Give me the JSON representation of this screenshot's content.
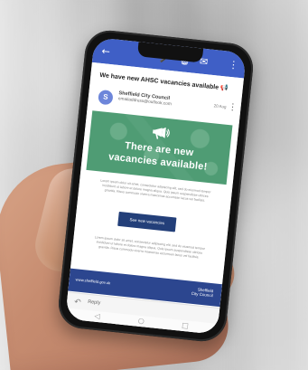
{
  "email": {
    "subject": "We have new AHSC vacancies available 📢",
    "sender_initial": "S",
    "sender_name": "Sheffield City Council",
    "sender_email": "emailaddress@outlook.com",
    "date": "20 Aug",
    "hero_line1": "There are new",
    "hero_line2": "vacancies available!",
    "body_text_1": "Lorem ipsum dolor sit amet, consectetur adipiscing elit, sed do eiusmod tempor incididunt ut labore et dolore magna aliqua. Quis ipsum suspendisse ultrices gravida. Risus commodo viverra maecenas accumsan lacus vel facilisis.",
    "button_label": "See new vacancies",
    "body_text_2": "Lorem ipsum dolor sit amet, consectetur adipiscing elit, sed do eiusmod tempor incididunt ut labore et dolore magna aliqua. Quis ipsum suspendisse ultrices gravida. Risus commodo viverra maecenas accumsan lacus vel facilisis.",
    "footer_site": "www.sheffield.gov.uk",
    "footer_mark_line1": "Sheffield",
    "footer_mark_line2": "City Council",
    "reply_label": "Reply"
  },
  "icons": {
    "back": "←",
    "mic": "🎤",
    "trash": "🗑",
    "mail": "✉",
    "more": "⋮",
    "kebab": "⋮",
    "reply": "↶",
    "nav_back": "◁",
    "nav_home": "○",
    "nav_recent": "□"
  },
  "colors": {
    "header_blue": "#3f5fc6",
    "hero_green": "#4f9c74",
    "button_navy": "#233f79",
    "footer_blue": "#2c468f"
  }
}
